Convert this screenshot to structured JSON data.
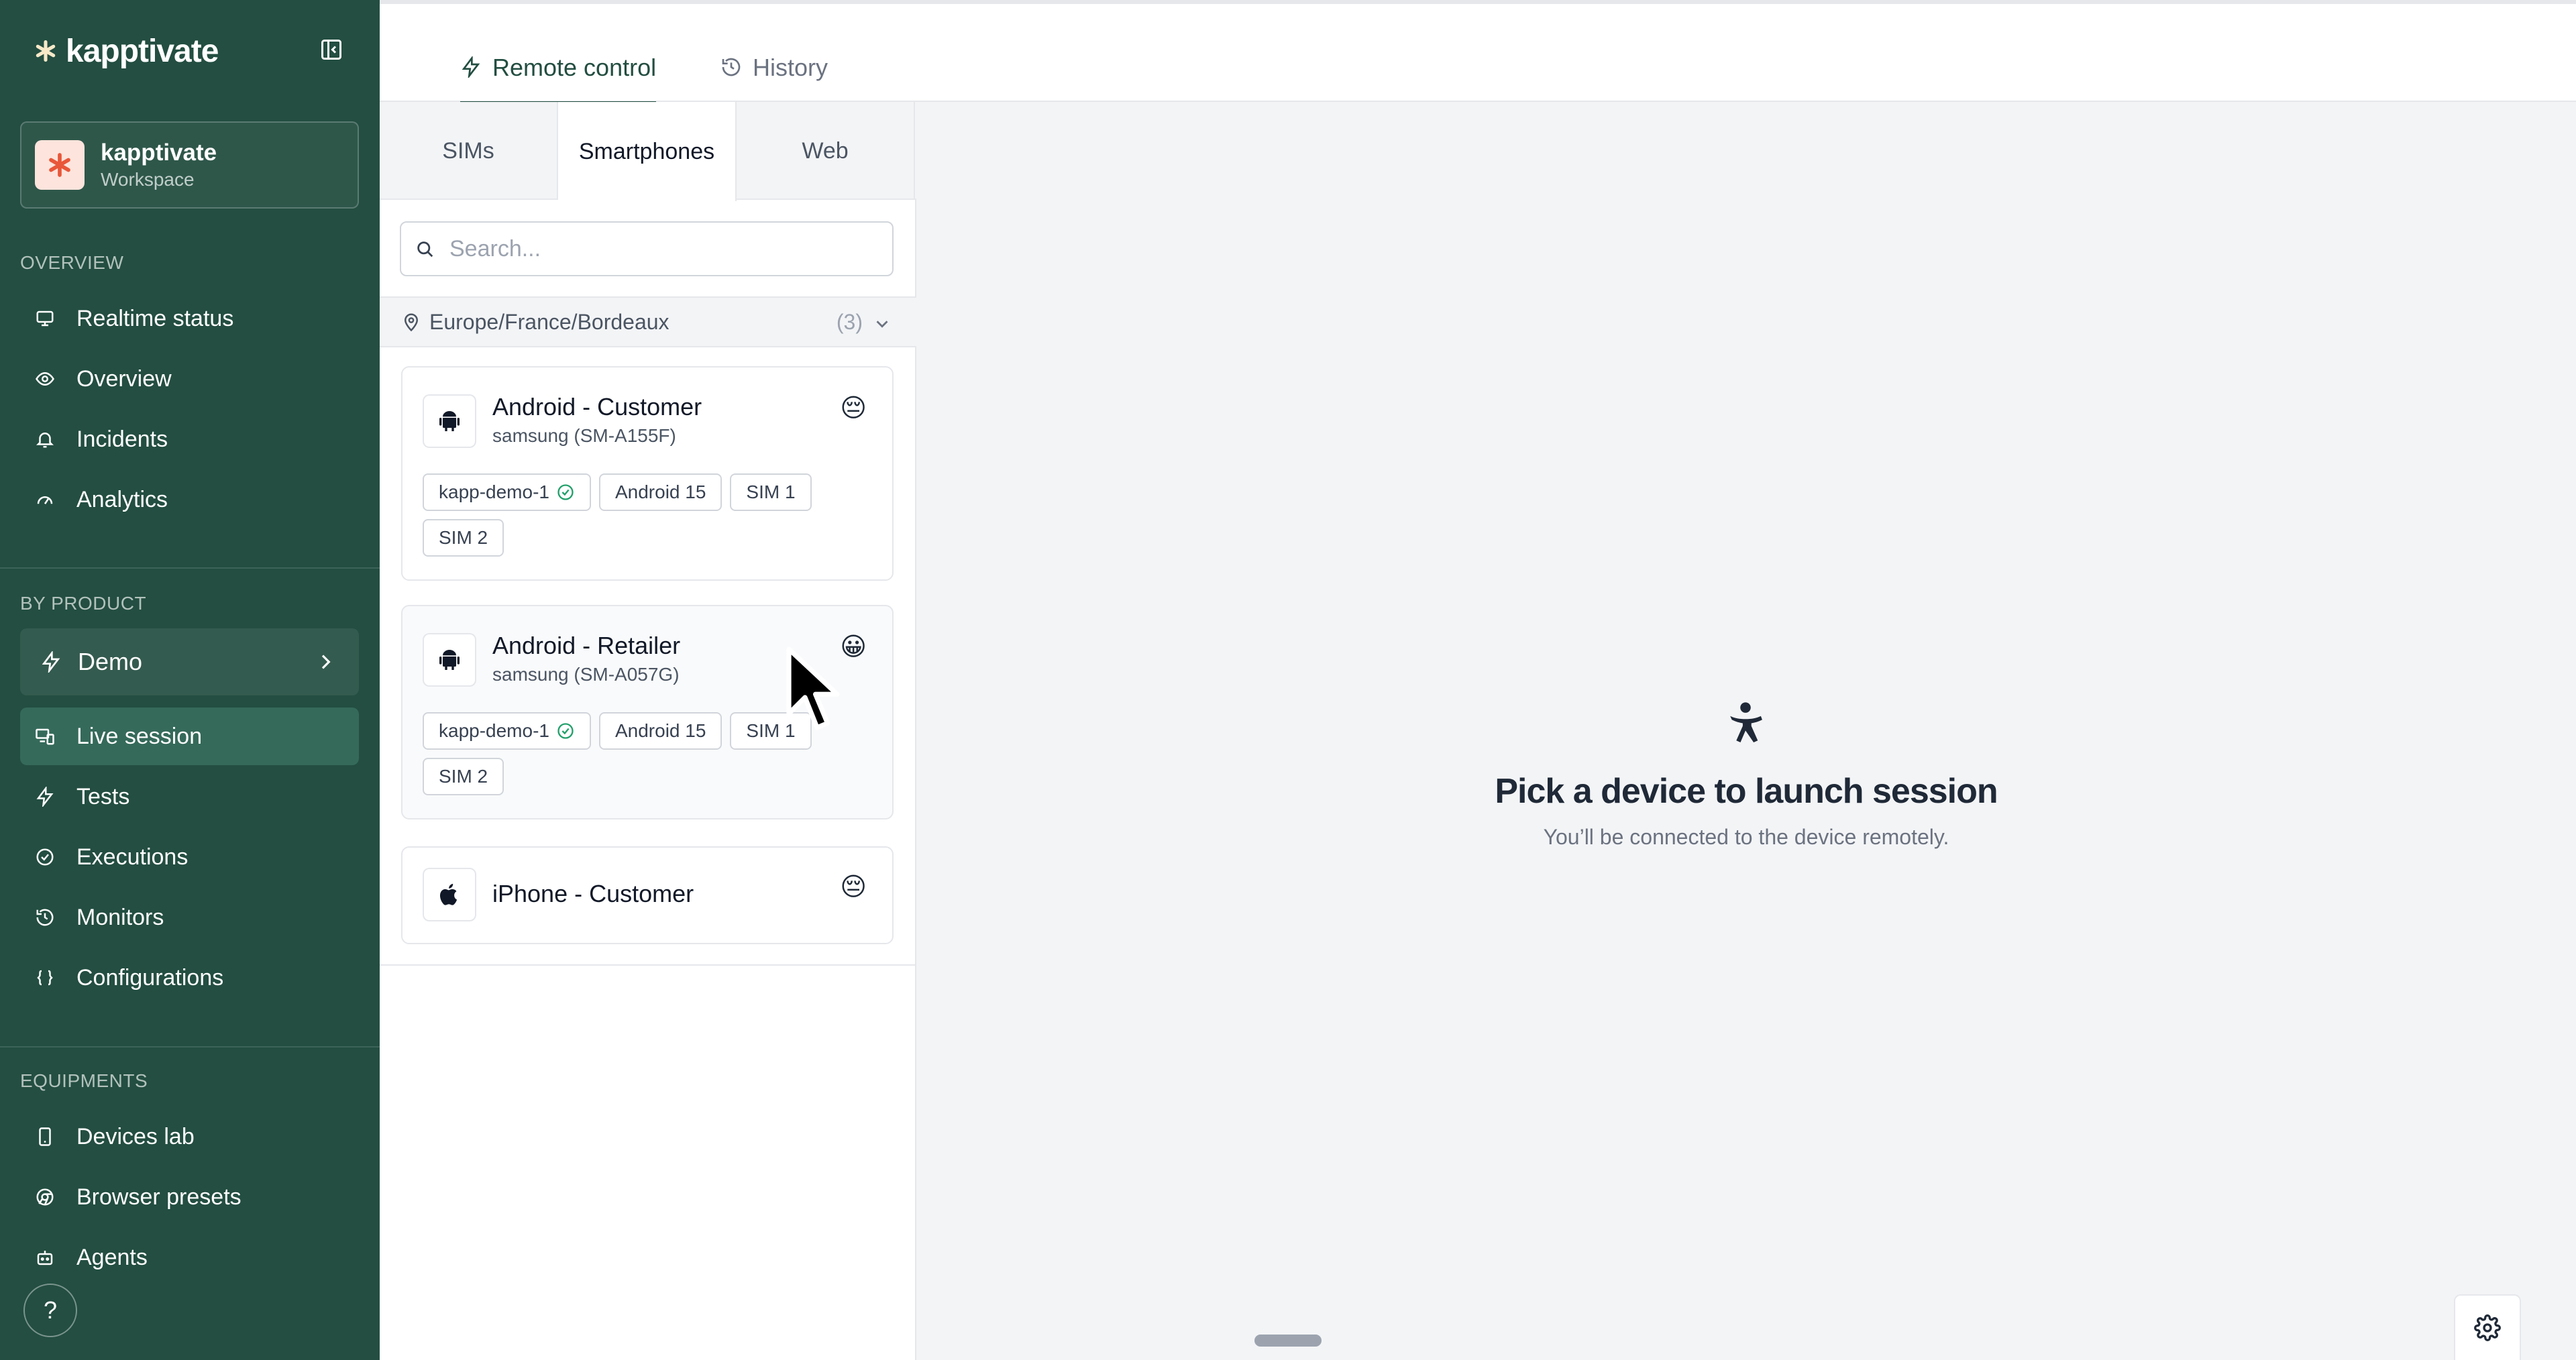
{
  "sidebar": {
    "logo_text": "kapptivate",
    "workspace": {
      "name": "kapptivate",
      "type": "Workspace"
    },
    "sections": {
      "overview": "OVERVIEW",
      "by_product": "BY PRODUCT",
      "equipments": "EQUIPMENTS"
    },
    "overview_items": [
      {
        "label": "Realtime status",
        "icon": "monitor-icon"
      },
      {
        "label": "Overview",
        "icon": "eye-icon"
      },
      {
        "label": "Incidents",
        "icon": "bell-icon"
      },
      {
        "label": "Analytics",
        "icon": "gauge-icon"
      }
    ],
    "product_selector": "Demo",
    "product_items": [
      {
        "label": "Live session",
        "icon": "devices-icon",
        "active": true
      },
      {
        "label": "Tests",
        "icon": "bolt-icon"
      },
      {
        "label": "Executions",
        "icon": "check-circle-icon"
      },
      {
        "label": "Monitors",
        "icon": "history-icon"
      },
      {
        "label": "Configurations",
        "icon": "braces-icon"
      }
    ],
    "equipment_items": [
      {
        "label": "Devices lab",
        "icon": "phone-icon"
      },
      {
        "label": "Browser presets",
        "icon": "chrome-icon"
      },
      {
        "label": "Agents",
        "icon": "bot-icon"
      }
    ],
    "help_label": "?"
  },
  "header": {
    "tabs": [
      {
        "label": "Remote control",
        "active": true
      },
      {
        "label": "History",
        "active": false
      }
    ]
  },
  "device_panel": {
    "subtabs": [
      "SIMs",
      "Smartphones",
      "Web"
    ],
    "active_subtab": "Smartphones",
    "search": {
      "placeholder": "Search...",
      "value": ""
    },
    "location": {
      "path": "Europe/France/Bordeaux",
      "count": "(3)"
    },
    "devices": [
      {
        "name": "Android - Customer",
        "model": "samsung (SM-A155F)",
        "os": "android",
        "status_emoji": "😔",
        "tags": [
          "kapp-demo-1",
          "Android 15",
          "SIM 1",
          "SIM 2"
        ]
      },
      {
        "name": "Android - Retailer",
        "model": "samsung (SM-A057G)",
        "os": "android",
        "status_emoji": "😀",
        "tags": [
          "kapp-demo-1",
          "Android 15",
          "SIM 1",
          "SIM 2"
        ]
      },
      {
        "name": "iPhone - Customer",
        "model": "",
        "os": "ios",
        "status_emoji": "😔",
        "tags": []
      }
    ]
  },
  "main": {
    "empty_title": "Pick a device to launch session",
    "empty_subtitle": "You’ll be connected to the device remotely."
  },
  "colors": {
    "sidebar_bg": "#234e41",
    "sidebar_active": "#356a5a",
    "accent": "#234e41",
    "success": "#22a06b",
    "main_bg": "#f3f4f6"
  }
}
